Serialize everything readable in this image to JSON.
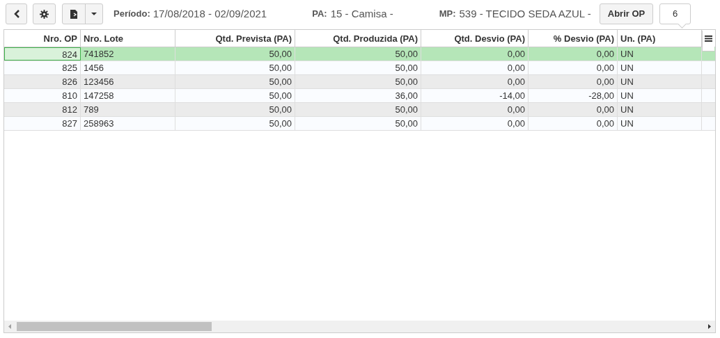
{
  "toolbar": {
    "periodo_label": "Período:",
    "periodo": "17/08/2018 - 02/09/2021",
    "pa_label": "PA:",
    "pa": "15 - Camisa -",
    "mp_label": "MP:",
    "mp": "539 - TECIDO SEDA AZUL -",
    "open_button": "Abrir OP",
    "count": "6"
  },
  "table": {
    "columns": [
      "Nro. OP",
      "Nro. Lote",
      "Qtd. Prevista (PA)",
      "Qtd. Produzida (PA)",
      "Qtd. Desvio (PA)",
      "% Desvio (PA)",
      "Un. (PA)"
    ],
    "rows": [
      {
        "selected": true,
        "cells": [
          "824",
          "741852",
          "50,00",
          "50,00",
          "0,00",
          "0,00",
          "UN"
        ]
      },
      {
        "selected": false,
        "cells": [
          "825",
          "1456",
          "50,00",
          "50,00",
          "0,00",
          "0,00",
          "UN"
        ]
      },
      {
        "selected": false,
        "cells": [
          "826",
          "123456",
          "50,00",
          "50,00",
          "0,00",
          "0,00",
          "UN"
        ]
      },
      {
        "selected": false,
        "cells": [
          "810",
          "147258",
          "50,00",
          "36,00",
          "-14,00",
          "-28,00",
          "UN"
        ]
      },
      {
        "selected": false,
        "cells": [
          "812",
          "789",
          "50,00",
          "50,00",
          "0,00",
          "0,00",
          "UN"
        ]
      },
      {
        "selected": false,
        "cells": [
          "827",
          "258963",
          "50,00",
          "50,00",
          "0,00",
          "0,00",
          "UN"
        ]
      }
    ]
  }
}
